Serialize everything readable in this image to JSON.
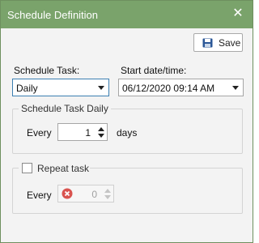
{
  "dialog": {
    "title": "Schedule Definition",
    "close_glyph": "✕"
  },
  "toolbar": {
    "save_label": "Save",
    "save_icon": "floppy-disk-icon"
  },
  "schedule_task": {
    "label": "Schedule Task:",
    "value": "Daily"
  },
  "start_datetime": {
    "label": "Start date/time:",
    "value": "06/12/2020 09:14 AM"
  },
  "daily_group": {
    "legend": "Schedule Task Daily",
    "every_label": "Every",
    "every_value": "1",
    "unit_label": "days"
  },
  "repeat_group": {
    "legend": "Repeat task",
    "checked": false,
    "every_label": "Every",
    "every_value": "0",
    "error_icon": "error-x-icon"
  },
  "colors": {
    "titlebar": "#7aa36b",
    "focus_border": "#3c7fb1",
    "error_red": "#d9534f",
    "save_icon_blue": "#2b5797"
  }
}
